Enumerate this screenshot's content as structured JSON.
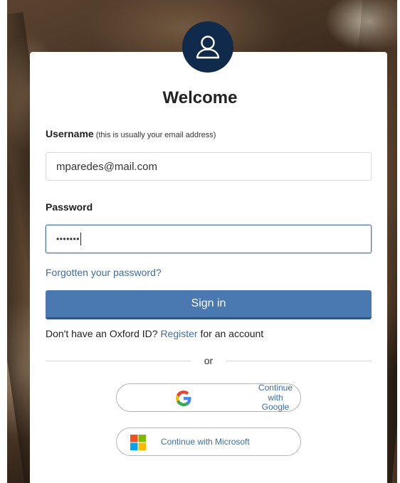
{
  "header": {
    "title": "Welcome"
  },
  "username": {
    "label": "Username",
    "hint": "(this is usually your email address)",
    "value": "mparedes@mail.com"
  },
  "password": {
    "label": "Password",
    "value_masked": "•••••••"
  },
  "links": {
    "forgot": "Forgotten your password?"
  },
  "actions": {
    "sign_in": "Sign in"
  },
  "register": {
    "prefix": "Don't have an Oxford ID?",
    "link": "Register",
    "suffix": "for an account"
  },
  "divider": {
    "label": "or"
  },
  "social": {
    "google": {
      "line1": "Continue",
      "line2": "with",
      "line3": "Google",
      "icon": "google-icon"
    },
    "microsoft": {
      "label": "Continue with Microsoft",
      "icon": "microsoft-icon"
    }
  },
  "colors": {
    "accent": "#4a78b0",
    "link": "#3d6ea6",
    "avatar": "#0f2a4a"
  }
}
